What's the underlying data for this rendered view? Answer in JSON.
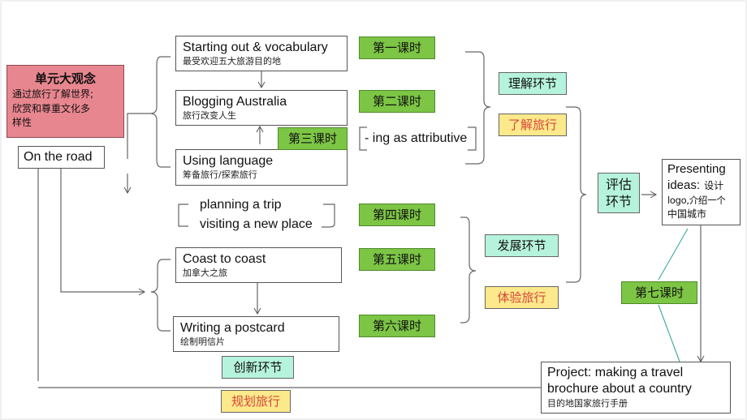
{
  "big_idea": {
    "title": "单元大观念",
    "line1": "通过旅行了解世界;",
    "line2": "欣赏和尊重文化多",
    "line3": "样性"
  },
  "unit": {
    "title": "On the road"
  },
  "sections": [
    {
      "en": "Starting out & vocabulary",
      "zh": "最受欢迎五大旅游目的地"
    },
    {
      "en": "Blogging Australia",
      "zh": "旅行改变人生"
    },
    {
      "en": "Using language",
      "zh": "筹备旅行/探索旅行"
    },
    {
      "en": "Coast to coast",
      "zh": "加拿大之旅"
    },
    {
      "en": "Writing a postcard",
      "zh": "绘制明信片"
    }
  ],
  "grammar_note": "- ing as attributive",
  "speaking_topics": [
    "planning a trip",
    "visiting a new place"
  ],
  "lessons": [
    "第一课时",
    "第二课时",
    "第三课时",
    "第四课时",
    "第五课时",
    "第六课时",
    "第七课时"
  ],
  "stages": {
    "understanding": "理解环节",
    "development": "发展环节",
    "evaluation": "评估环节",
    "innovation": "创新环节"
  },
  "travel_phases": {
    "learn": "了解旅行",
    "experience": "体验旅行",
    "plan": "规划旅行"
  },
  "presenting": {
    "en1": "Presenting",
    "en2": "ideas:",
    "zh1": "设计",
    "zh2": "logo,介绍一个",
    "zh3": "中国城市"
  },
  "project": {
    "line1": "Project: making a travel",
    "line2": "brochure about a country",
    "zh": "目的地国家旅行手册"
  },
  "colors": {
    "big_idea_bg": "#e8868f",
    "lesson_bg": "#7cc545",
    "stage_bg": "#b6f3dc",
    "travel_bg": "#fbe98b",
    "travel_text": "#d9453a",
    "connector_teal": "#3aa89a"
  }
}
